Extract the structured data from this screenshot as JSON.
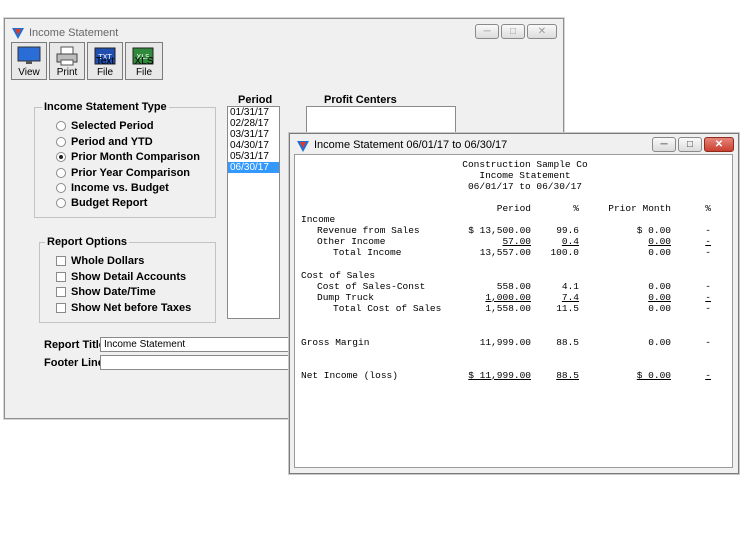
{
  "main_window": {
    "title": "Income Statement",
    "toolbar": [
      {
        "label": "View",
        "icon": "monitor-icon"
      },
      {
        "label": "Print",
        "icon": "printer-icon"
      },
      {
        "label": "Text File",
        "icon": "text-file-icon"
      },
      {
        "label": "XLS File",
        "icon": "xls-file-icon"
      }
    ],
    "type_group": {
      "label": "Income Statement Type",
      "options": [
        {
          "label": "Selected Period",
          "selected": false
        },
        {
          "label": "Period and YTD",
          "selected": false
        },
        {
          "label": "Prior Month Comparison",
          "selected": true
        },
        {
          "label": "Prior Year Comparison",
          "selected": false
        },
        {
          "label": "Income vs. Budget",
          "selected": false
        },
        {
          "label": "Budget Report",
          "selected": false
        }
      ]
    },
    "options_group": {
      "label": "Report Options",
      "items": [
        "Whole Dollars",
        "Show Detail Accounts",
        "Show Date/Time",
        "Show Net before Taxes"
      ]
    },
    "period": {
      "label": "Period",
      "items": [
        "01/31/17",
        "02/28/17",
        "03/31/17",
        "04/30/17",
        "05/31/17",
        "06/30/17"
      ],
      "selected_index": 5
    },
    "profit_centers": {
      "label": "Profit Centers"
    },
    "report_title": {
      "label": "Report Title",
      "value": "Income Statement"
    },
    "footer_line": {
      "label": "Footer Line",
      "value": ""
    }
  },
  "report_window": {
    "title": "Income Statement 06/01/17 to 06/30/17",
    "company": "Construction Sample Co",
    "heading": "Income Statement",
    "range": "06/01/17 to 06/30/17",
    "columns": {
      "period": "Period",
      "pct": "%",
      "prior": "Prior Month",
      "pct2": "%"
    },
    "rows": [
      {
        "label": "Income",
        "indent": 0
      },
      {
        "label": "Revenue from Sales",
        "indent": 1,
        "period": "$ 13,500.00",
        "pct": "99.6",
        "prior": "$ 0.00",
        "pct2": "-"
      },
      {
        "label": "Other Income",
        "indent": 1,
        "period": "57.00",
        "pct": "0.4",
        "prior": "0.00",
        "pct2": "-",
        "underline": true
      },
      {
        "label": "Total Income",
        "indent": 2,
        "period": "13,557.00",
        "pct": "100.0",
        "prior": "0.00",
        "pct2": "-"
      },
      {
        "label": "",
        "indent": 0
      },
      {
        "label": "Cost of Sales",
        "indent": 0
      },
      {
        "label": "Cost of Sales-Const",
        "indent": 1,
        "period": "558.00",
        "pct": "4.1",
        "prior": "0.00",
        "pct2": "-"
      },
      {
        "label": "Dump Truck",
        "indent": 1,
        "period": "1,000.00",
        "pct": "7.4",
        "prior": "0.00",
        "pct2": "-",
        "underline": true
      },
      {
        "label": "Total Cost of Sales",
        "indent": 2,
        "period": "1,558.00",
        "pct": "11.5",
        "prior": "0.00",
        "pct2": "-"
      },
      {
        "label": "",
        "indent": 0
      },
      {
        "label": "",
        "indent": 0
      },
      {
        "label": "Gross Margin",
        "indent": 0,
        "period": "11,999.00",
        "pct": "88.5",
        "prior": "0.00",
        "pct2": "-"
      },
      {
        "label": "",
        "indent": 0
      },
      {
        "label": "",
        "indent": 0
      },
      {
        "label": "Net Income (loss)",
        "indent": 0,
        "period": "$ 11,999.00",
        "pct": "88.5",
        "prior": "$ 0.00",
        "pct2": "-",
        "underline": true
      }
    ]
  }
}
